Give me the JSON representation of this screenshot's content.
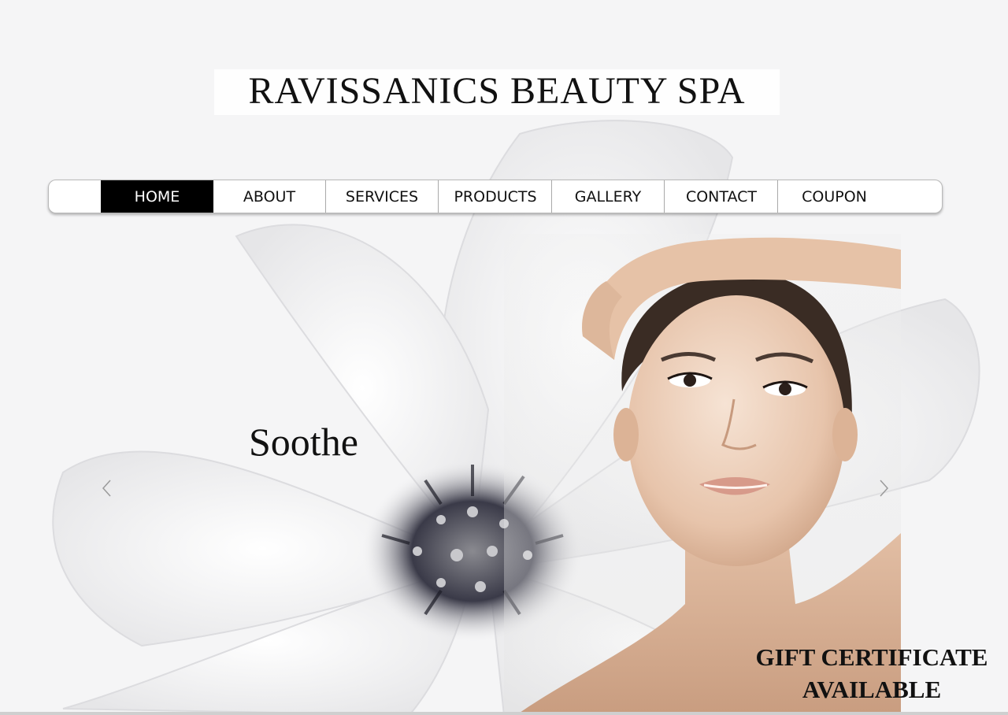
{
  "header": {
    "site_title": "RAVISSANICS BEAUTY SPA"
  },
  "nav": {
    "items": [
      {
        "label": "HOME",
        "active": true
      },
      {
        "label": "ABOUT",
        "active": false
      },
      {
        "label": "SERVICES",
        "active": false
      },
      {
        "label": "PRODUCTS",
        "active": false
      },
      {
        "label": "GALLERY",
        "active": false
      },
      {
        "label": "CONTACT",
        "active": false
      },
      {
        "label": "COUPON",
        "active": false
      }
    ]
  },
  "slider": {
    "caption": "Soothe",
    "prev_icon": "chevron-left-icon",
    "next_icon": "chevron-right-icon"
  },
  "promo": {
    "line1": "GIFT CERTIFICATE",
    "line2": "AVAILABLE"
  },
  "colors": {
    "nav_active_bg": "#000000",
    "nav_active_text": "#ffffff",
    "page_bg": "#f4f4f5"
  }
}
